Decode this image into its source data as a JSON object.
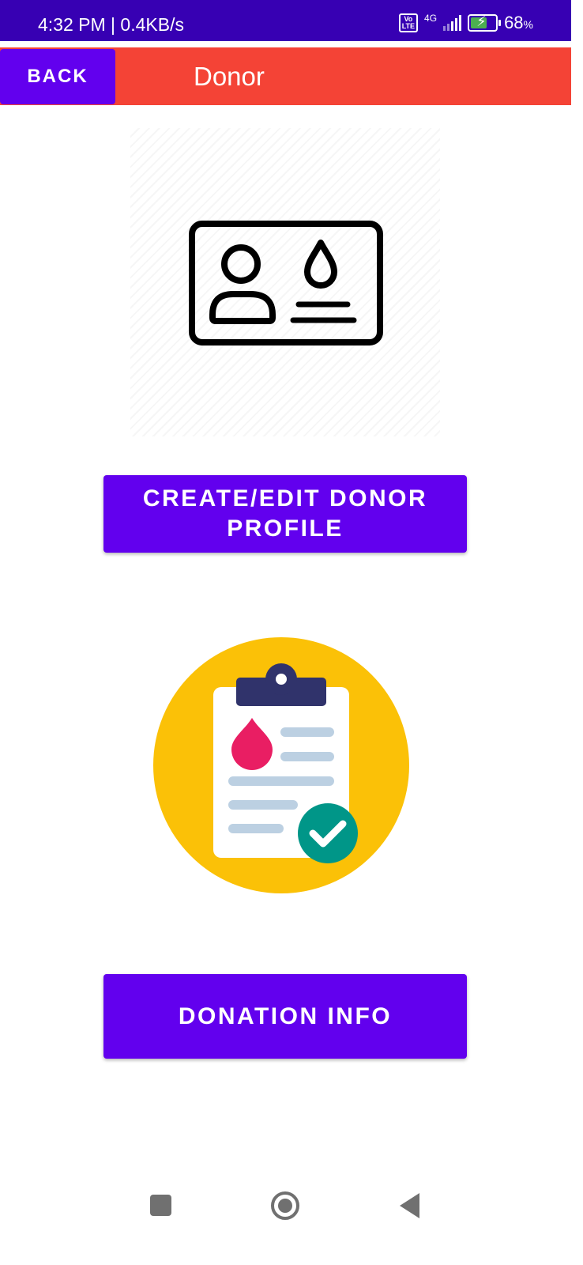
{
  "status_bar": {
    "time_speed": "4:32 PM | 0.4KB/s",
    "volte_line1": "Vo",
    "volte_line2": "LTE",
    "network": "4G",
    "battery_percent": "68",
    "battery_percent_sign": "%",
    "battery_level": 0.68,
    "battery_charging": true
  },
  "toolbar": {
    "back_label": "BACK",
    "title": "Donor"
  },
  "profile_card_icon": "id-card-blood-drop-icon",
  "buttons": {
    "profile_label": "CREATE/EDIT DONOR PROFILE",
    "donation_label": "DONATION INFO"
  },
  "clipboard_icon": "blood-report-clipboard-check-icon",
  "colors": {
    "status_bar": "#3700b3",
    "toolbar": "#f44336",
    "primary": "#6200ee",
    "illustration_circle": "#fbc107",
    "clipboard_clip": "#30336b",
    "blood_drop": "#e91e63",
    "check_circle": "#009688"
  },
  "nav_bar": {
    "recents_icon": "recents-square-icon",
    "home_icon": "home-circle-icon",
    "back_icon": "back-triangle-icon"
  }
}
